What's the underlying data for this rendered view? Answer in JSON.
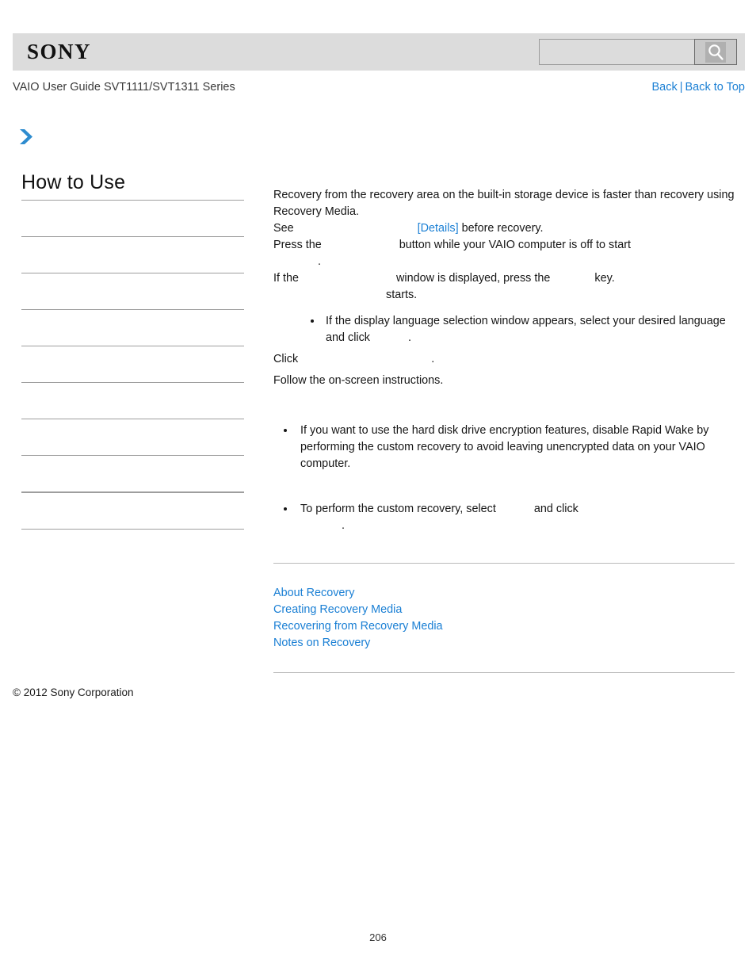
{
  "header": {
    "logo_text": "SONY",
    "search": {
      "value": "",
      "placeholder": "",
      "button_icon": "search-icon"
    }
  },
  "subheader": {
    "guide_title": "VAIO User Guide SVT1111/SVT1311 Series",
    "nav": {
      "back_label": "Back",
      "separator": "|",
      "back_to_top_label": "Back to Top"
    }
  },
  "breadcrumb": {
    "icon": "chevron-right-icon"
  },
  "sidebar": {
    "title": "How to Use",
    "items": [
      {
        "label": ""
      },
      {
        "label": ""
      },
      {
        "label": ""
      },
      {
        "label": ""
      },
      {
        "label": ""
      },
      {
        "label": ""
      },
      {
        "label": ""
      },
      {
        "label": ""
      },
      {
        "label": ""
      },
      {
        "label": ""
      }
    ]
  },
  "main": {
    "intro_line_1": "Recovery from the recovery area on the built-in storage device is faster than recovery using",
    "intro_line_2": "Recovery Media.",
    "see_prefix": "See",
    "see_link": "[Details]",
    "see_suffix": "before recovery.",
    "step_1_prefix": "Press the",
    "step_1_mid": "button while your VAIO computer is off to start",
    "step_1_tail": ".",
    "step_2_prefix": "If the",
    "step_2_mid": "window is displayed, press the",
    "step_2_suffix": "key.",
    "step_2_tail": "starts.",
    "bullet_1_line_1": "If the display language selection window appears, select your desired language",
    "bullet_1_line_2_prefix": "and click",
    "bullet_1_line_2_tail": ".",
    "step_3_prefix": "Click",
    "step_3_tail": ".",
    "step_4": "Follow the on-screen instructions.",
    "note_1_line_1": "If you want to use the hard disk drive encryption features, disable Rapid Wake by",
    "note_1_line_2": "performing the custom recovery to avoid leaving unencrypted data on your VAIO",
    "note_1_line_3": "computer.",
    "note_2_prefix": "To perform the custom recovery, select",
    "note_2_mid": "and click",
    "note_2_tail": "."
  },
  "related_topics": {
    "links": [
      "About Recovery",
      "Creating Recovery Media",
      "Recovering from Recovery Media",
      "Notes on Recovery"
    ]
  },
  "footer": {
    "copyright": "© 2012 Sony Corporation",
    "page_number": "206"
  },
  "colors": {
    "link_blue": "#1a7fd4",
    "header_gray": "#dcdcdc",
    "rule_gray": "#9e9e9e"
  }
}
